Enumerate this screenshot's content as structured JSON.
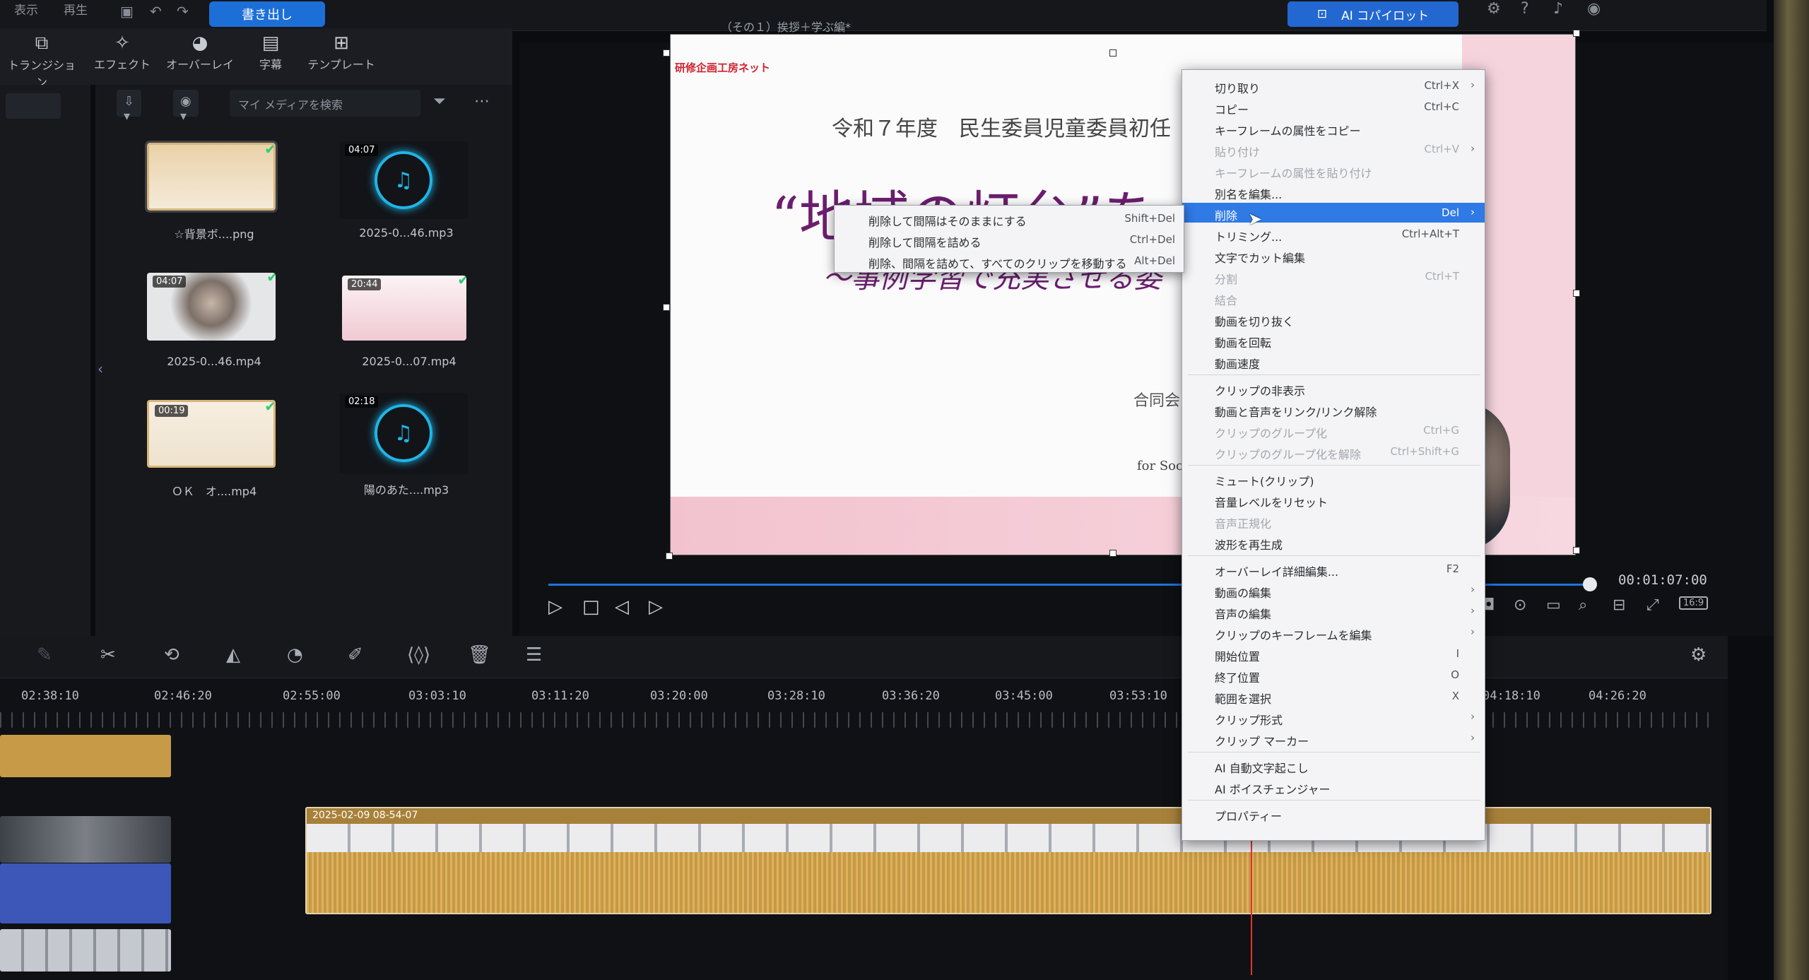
{
  "topbar": {
    "menu_view": "表示",
    "menu_play": "再生",
    "export_label": "書き出し",
    "window_title": "（その１）挨拶＋学ぶ編*",
    "ai_copilot_label": "AI コパイロット"
  },
  "library": {
    "tabs": [
      {
        "label": "トランジション",
        "icon": "transition-icon"
      },
      {
        "label": "エフェクト",
        "icon": "effect-icon"
      },
      {
        "label": "オーバーレイ",
        "icon": "overlay-icon"
      },
      {
        "label": "字幕",
        "icon": "subtitle-icon"
      },
      {
        "label": "テンプレート",
        "icon": "template-icon"
      }
    ],
    "search_placeholder": "マイ メディアを検索",
    "items": [
      {
        "label": "☆背景ボ....png",
        "duration": "",
        "type": "image",
        "checked": true
      },
      {
        "label": "2025-0...46.mp3",
        "duration": "04:07",
        "type": "audio",
        "checked": false
      },
      {
        "label": "2025-0...46.mp4",
        "duration": "04:07",
        "type": "video",
        "checked": true
      },
      {
        "label": "2025-0...07.mp4",
        "duration": "20:44",
        "type": "video",
        "checked": true
      },
      {
        "label": "ＯＫ　オ....mp4",
        "duration": "00:19",
        "type": "video",
        "checked": true
      },
      {
        "label": "陽のあた....mp3",
        "duration": "02:18",
        "type": "audio",
        "checked": false
      }
    ]
  },
  "preview": {
    "slide_logo": "研修企画工房ネット",
    "slide_year": "令和７年度　民生委員児童委員初任",
    "slide_title": "“地域の灯台”を",
    "slide_subtitle": "～事例学習で充実させる委",
    "slide_company": "合同会",
    "slide_for": "for Soc",
    "timecode": "00:01:07:00",
    "ratio": "16:9"
  },
  "context_menu": {
    "items": [
      {
        "label": "切り取り",
        "shortcut": "Ctrl+X",
        "arrow": true,
        "disabled": false
      },
      {
        "label": "コピー",
        "shortcut": "Ctrl+C",
        "arrow": false,
        "disabled": false
      },
      {
        "label": "キーフレームの属性をコピー",
        "shortcut": "",
        "arrow": false,
        "disabled": false
      },
      {
        "label": "貼り付け",
        "shortcut": "Ctrl+V",
        "arrow": true,
        "disabled": true
      },
      {
        "label": "キーフレームの属性を貼り付け",
        "shortcut": "",
        "arrow": false,
        "disabled": true
      },
      {
        "label": "別名を編集...",
        "shortcut": "",
        "arrow": false,
        "disabled": false
      },
      {
        "label": "削除",
        "shortcut": "Del",
        "arrow": true,
        "disabled": false,
        "highlighted": true
      },
      {
        "label": "トリミング...",
        "shortcut": "Ctrl+Alt+T",
        "arrow": false,
        "disabled": false
      },
      {
        "label": "文字でカット編集",
        "shortcut": "",
        "arrow": false,
        "disabled": false
      },
      {
        "label": "分割",
        "shortcut": "Ctrl+T",
        "arrow": false,
        "disabled": true
      },
      {
        "label": "結合",
        "shortcut": "",
        "arrow": false,
        "disabled": true
      },
      {
        "label": "動画を切り抜く",
        "shortcut": "",
        "arrow": false,
        "disabled": false
      },
      {
        "label": "動画を回転",
        "shortcut": "",
        "arrow": false,
        "disabled": false
      },
      {
        "label": "動画速度",
        "shortcut": "",
        "arrow": false,
        "disabled": false
      },
      {
        "label": "クリップの非表示",
        "shortcut": "",
        "arrow": false,
        "disabled": false
      },
      {
        "label": "動画と音声をリンク/リンク解除",
        "shortcut": "",
        "arrow": false,
        "disabled": false
      },
      {
        "label": "クリップのグループ化",
        "shortcut": "Ctrl+G",
        "arrow": false,
        "disabled": true
      },
      {
        "label": "クリップのグループ化を解除",
        "shortcut": "Ctrl+Shift+G",
        "arrow": false,
        "disabled": true
      },
      {
        "label": "ミュート(クリップ)",
        "shortcut": "",
        "arrow": false,
        "disabled": false
      },
      {
        "label": "音量レベルをリセット",
        "shortcut": "",
        "arrow": false,
        "disabled": false
      },
      {
        "label": "音声正規化",
        "shortcut": "",
        "arrow": false,
        "disabled": true
      },
      {
        "label": "波形を再生成",
        "shortcut": "",
        "arrow": false,
        "disabled": false
      },
      {
        "label": "オーバーレイ詳細編集...",
        "shortcut": "F2",
        "arrow": false,
        "disabled": false
      },
      {
        "label": "動画の編集",
        "shortcut": "",
        "arrow": true,
        "disabled": false
      },
      {
        "label": "音声の編集",
        "shortcut": "",
        "arrow": true,
        "disabled": false
      },
      {
        "label": "クリップのキーフレームを編集",
        "shortcut": "",
        "arrow": true,
        "disabled": false
      },
      {
        "label": "開始位置",
        "shortcut": "I",
        "arrow": false,
        "disabled": false
      },
      {
        "label": "終了位置",
        "shortcut": "O",
        "arrow": false,
        "disabled": false
      },
      {
        "label": "範囲を選択",
        "shortcut": "X",
        "arrow": false,
        "disabled": false
      },
      {
        "label": "クリップ形式",
        "shortcut": "",
        "arrow": true,
        "disabled": false
      },
      {
        "label": "クリップ マーカー",
        "shortcut": "",
        "arrow": true,
        "disabled": false
      },
      {
        "label": "AI 自動文字起こし",
        "shortcut": "",
        "arrow": false,
        "disabled": false
      },
      {
        "label": "AI ボイスチェンジャー",
        "shortcut": "",
        "arrow": false,
        "disabled": false
      },
      {
        "label": "プロパティー",
        "shortcut": "",
        "arrow": false,
        "disabled": false
      }
    ]
  },
  "submenu": {
    "items": [
      {
        "label": "削除して間隔はそのままにする",
        "shortcut": "Shift+Del"
      },
      {
        "label": "削除して間隔を詰める",
        "shortcut": "Ctrl+Del"
      },
      {
        "label": "削除、間隔を詰めて、すべてのクリップを移動する",
        "shortcut": "Alt+Del"
      }
    ]
  },
  "timeline": {
    "ruler": [
      "02:38:10",
      "02:46:20",
      "02:55:00",
      "03:03:10",
      "03:11:20",
      "03:20:00",
      "03:28:10",
      "03:36:20",
      "03:45:00",
      "03:53:10",
      "04:18:10",
      "04:26:20"
    ],
    "main_clip_name": "2025-02-09 08-54-07"
  }
}
